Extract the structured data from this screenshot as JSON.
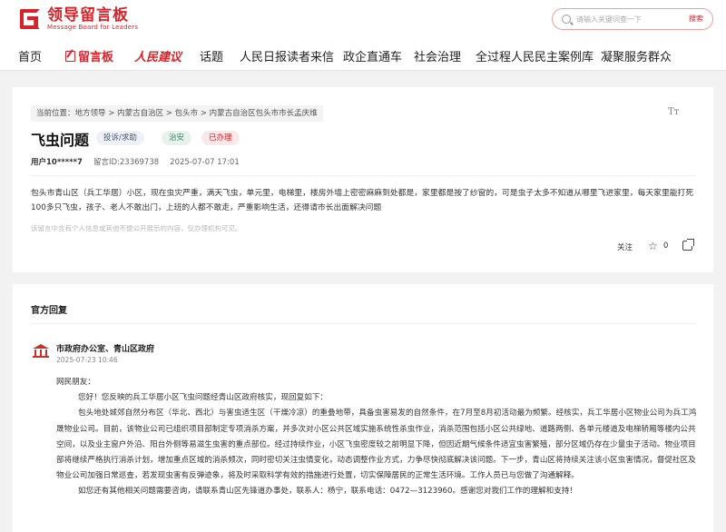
{
  "header": {
    "logo_title": "领导留言板",
    "logo_sub": "Message Board for Leaders",
    "search_placeholder": "请输入关键词查一下",
    "search_button": "搜索"
  },
  "nav": {
    "items": [
      "首页",
      "留言板",
      "人民建议",
      "话题",
      "人民日报读者来信",
      "政企直通车",
      "社会治理",
      "全过程人民民主案例库",
      "凝聚服务群众"
    ]
  },
  "message": {
    "breadcrumb_prefix": "当前位置：",
    "breadcrumb": [
      "地方领导",
      "内蒙古自治区",
      "包头市",
      "内蒙古自治区包头市市长孟庆维"
    ],
    "breadcrumb_sep": ">",
    "font_toggle": "Tт",
    "title": "飞虫问题",
    "tags": {
      "type": "投诉/求助",
      "domain": "治安",
      "status": "已办理"
    },
    "user": "用户10*****7",
    "msg_id": "留言ID:23369738",
    "date": "2025-07-07 17:01",
    "content": "包头市青山区（兵工华居）小区，现在虫灾严重，满天飞虫，单元里，电梯里，楼房外墙上密密麻麻到处都是，家里都是按了纱窗的，可是虫子太多不知道从哪里飞进家里，每天家里能打死100多只飞虫，孩子、老人不敢出门，上班的人都不敢走，严重影响生活，还得请市长出面解决问题",
    "disclaimer": "该留言中含有个人信息或其他不便公开展示的内容，仅办理机构可见。",
    "follow": "关注",
    "likes": "0"
  },
  "reply": {
    "heading": "官方回复",
    "org": "市政府办公室、青山区政府",
    "time": "2025-07-23 10:46",
    "greeting": "网民朋友：",
    "para1": "您好！您反映的兵工华居小区飞虫问题经青山区政府核实，现回复如下：",
    "para2": "包头地处城郊自然分布区（华北、西北）与害虫适生区（干燥冷凉）的重叠地带，具备虫害易发的自然条件，在7月至8月初活动最为频繁。经核实，兵工华居小区物业公司为兵工鸿晟物业公司。目前，该物业公司已组织项目部制定专项消杀方案，并多次对小区公共区域实施系统性杀虫作业，消杀范围包括小区公共绿地、道路两侧、各单元楼道及电梯轿厢等楼内公共空间，以及业主窗户外沿、阳台外侧等易滋生虫害的重点部位。经过持续作业，小区飞虫密度较之前明显下降，但因近期气候条件适宜虫害繁殖，部分区域仍存在少量虫子活动。物业项目部将继续严格执行消杀计划，增加重点区域的消杀频次，同时密切关注虫情变化，动态调整作业方式，力争尽快彻底解决该问题。下一步，青山区将持续关注该小区虫害情况，督促社区及物业公司加强日常巡查，若发现虫害有反弹迹象，将及时采取科学有效的措施进行处置，切实保障居民的正常生活环境。工作人员已与您做了沟通解释。",
    "para3": "如您还有其他相关问题需要咨询，请联系青山区先锋道办事处，联系人：杨宁，联系电话：0472—3123960。感谢您对我们工作的理解和支持！"
  }
}
